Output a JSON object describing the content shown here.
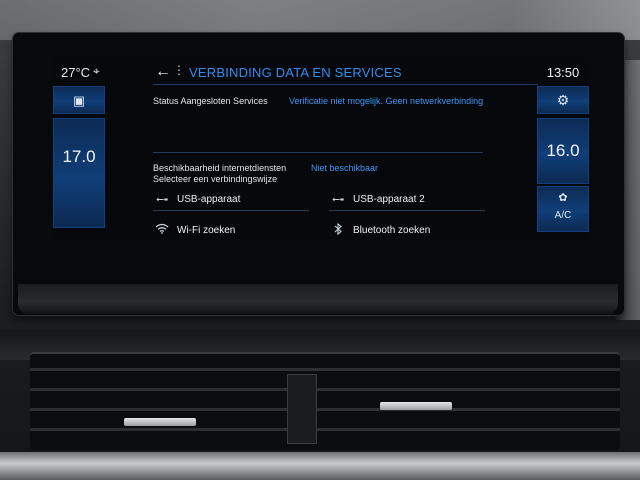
{
  "left_climate": {
    "outside_temp": "27°C",
    "location_icon": "location-pin-icon",
    "seat_icon": "screen-mirror-icon",
    "driver_temp": "17.0"
  },
  "header": {
    "back_icon": "back-arrow-icon",
    "menu_icon": "more-vertical-icon",
    "title": "VERBINDING DATA EN SERVICES"
  },
  "status": {
    "label": "Status Aangesloten Services",
    "value": "Verificatie niet mogelijk. Geen netwerkverbinding"
  },
  "internet": {
    "availability_label": "Beschikbaarheid internetdiensten",
    "availability_value": "Niet beschikbaar",
    "select_label": "Selecteer een verbindingswijze"
  },
  "options": [
    {
      "label": "USB-apparaat",
      "icon": "usb-icon"
    },
    {
      "label": "USB-apparaat 2",
      "icon": "usb-icon"
    },
    {
      "label": "Wi-Fi zoeken",
      "icon": "wifi-icon"
    },
    {
      "label": "Bluetooth zoeken",
      "icon": "bluetooth-icon"
    }
  ],
  "right_climate": {
    "time": "13:50",
    "settings_icon": "gear-icon",
    "passenger_temp": "16.0",
    "ac_label": "A/C"
  },
  "colors": {
    "accent_blue": "#2f8ef0",
    "tile_blue": "#103e78",
    "screen_bg": "#06080b"
  }
}
